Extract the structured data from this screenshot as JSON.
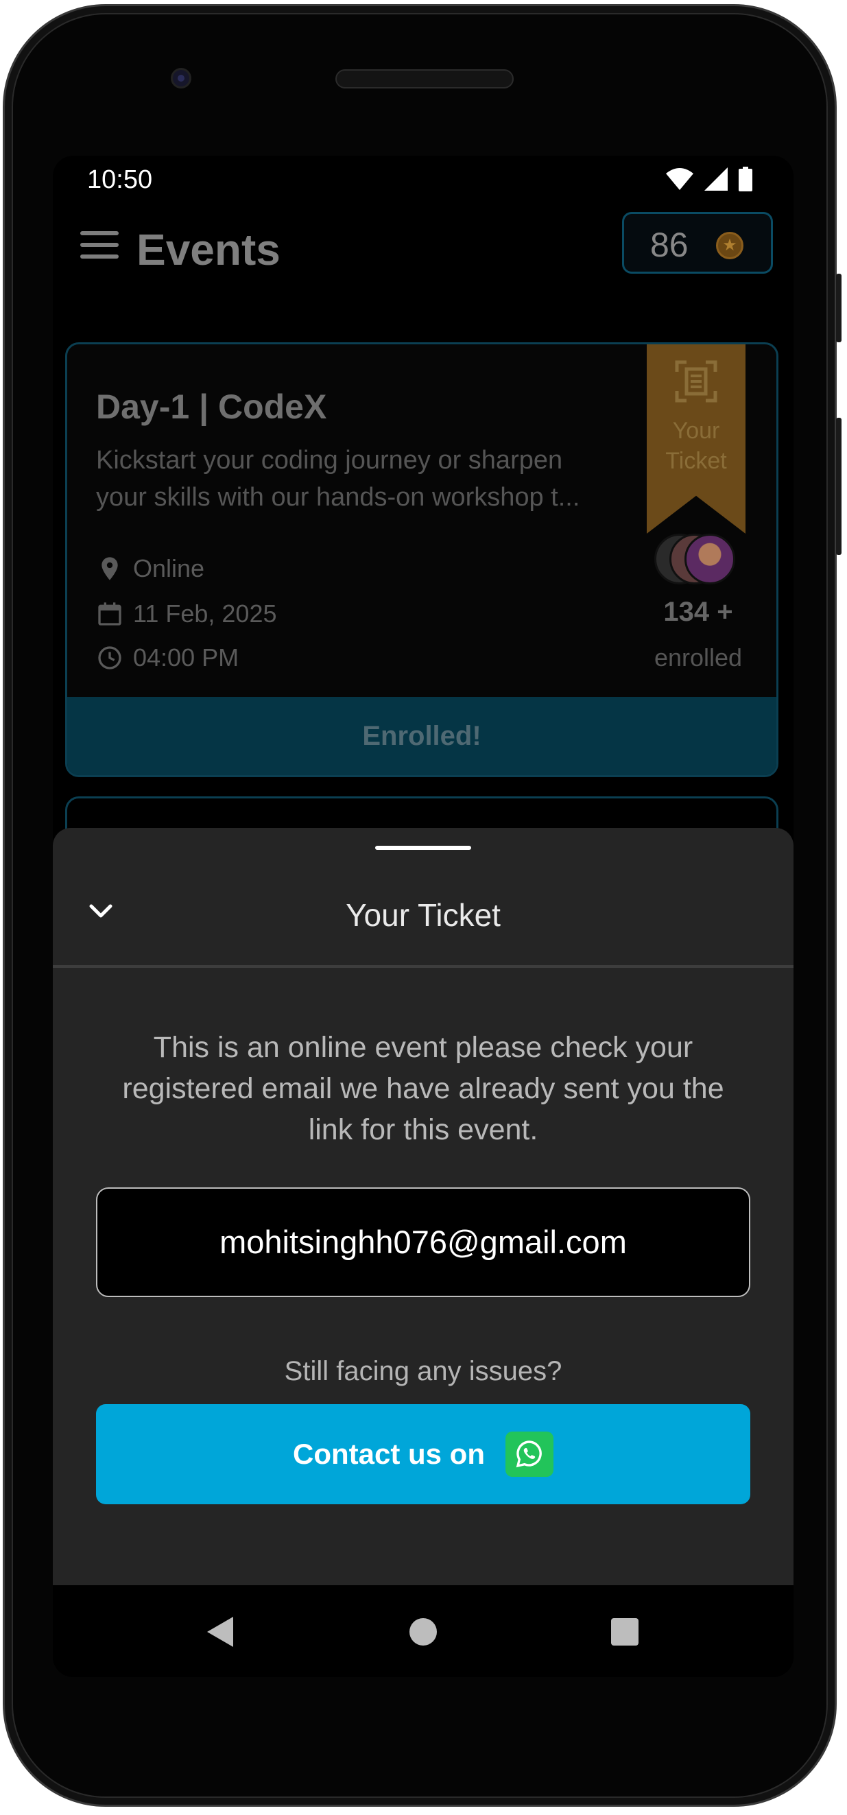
{
  "status_bar": {
    "time": "10:50",
    "icons": [
      "wifi-icon",
      "cell-signal-icon",
      "battery-icon"
    ]
  },
  "header": {
    "title": "Events",
    "menu_icon": "hamburger-menu-icon",
    "coins": "86",
    "coin_icon": "coin-star-icon"
  },
  "event": {
    "title": "Day-1 | CodeX",
    "description_line1": "Kickstart your coding journey or sharpen",
    "description_line2": "your skills with our hands-on workshop t...",
    "location": "Online",
    "date": "11 Feb, 2025",
    "time": "04:00 PM",
    "ribbon_label_line1": "Your",
    "ribbon_label_line2": "Ticket",
    "enrolled_count": "134 +",
    "enrolled_label": "enrolled",
    "status_button": "Enrolled!"
  },
  "ticket_sheet": {
    "title": "Your Ticket",
    "info": "This is an online event please check your registered email we have already sent you the link for this event.",
    "email": "mohitsinghh076@gmail.com",
    "issues_prompt": "Still facing any issues?",
    "contact_label": "Contact us on",
    "contact_icon": "whatsapp-icon"
  },
  "colors": {
    "accent": "#00a6d9",
    "sheet_bg": "#252525",
    "ribbon": "#6b4a19",
    "whatsapp": "#22c45a"
  }
}
